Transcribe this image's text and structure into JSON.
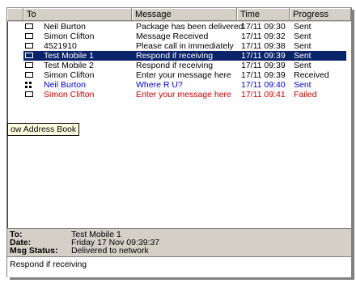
{
  "columns": [
    {
      "key": "icon",
      "label": ""
    },
    {
      "key": "to",
      "label": "To"
    },
    {
      "key": "message",
      "label": "Message"
    },
    {
      "key": "time",
      "label": "Time"
    },
    {
      "key": "progress",
      "label": "Progress"
    }
  ],
  "rows": [
    {
      "icon": "message-icon",
      "to": "Neil Burton",
      "message": "Package has been delivered",
      "time": "17/11 09:30",
      "progress": "Sent",
      "color": "#000000",
      "selected": false
    },
    {
      "icon": "message-icon",
      "to": "Simon Clifton",
      "message": "Message Received",
      "time": "17/11 09:32",
      "progress": "Sent",
      "color": "#000000",
      "selected": false
    },
    {
      "icon": "message-icon",
      "to": "4521910",
      "message": "Please call in immediately",
      "time": "17/11 09:38",
      "progress": "Sent",
      "color": "#000000",
      "selected": false
    },
    {
      "icon": "message-icon",
      "to": "Test Mobile 1",
      "message": "Respond if receiving",
      "time": "17/11 09:39",
      "progress": "Sent",
      "color": "#ffffff",
      "selected": true
    },
    {
      "icon": "message-icon",
      "to": "Test Mobile 2",
      "message": "Respond if receiving",
      "time": "17/11 09:39",
      "progress": "Sent",
      "color": "#000000",
      "selected": false
    },
    {
      "icon": "message-icon",
      "to": "Simon Clifton",
      "message": "Enter your message here",
      "time": "17/11 09:39",
      "progress": "Received",
      "color": "#000000",
      "selected": false
    },
    {
      "icon": "group-icon",
      "to": "Neil Burton",
      "message": "Where R U?",
      "time": "17/11 09:40",
      "progress": "Sent",
      "color": "#0000cc",
      "selected": false
    },
    {
      "icon": "message-icon",
      "to": "Simon Clifton",
      "message": "Enter your message here",
      "time": "17/11 09:41",
      "progress": "Failed",
      "color": "#cc0000",
      "selected": false
    }
  ],
  "tooltip": "ow Address Book",
  "details": {
    "to_label": "To:",
    "to_value": "Test Mobile 1",
    "date_label": "Date:",
    "date_value": "Friday 17 Nov 09:39:37",
    "status_label": "Msg Status:",
    "status_value": "Delivered to network"
  },
  "message_body": "Respond if receiving",
  "colors": {
    "header_bg": "#d4d0c8",
    "selection": "#0a246a",
    "failed": "#cc0000",
    "blue": "#0000cc"
  }
}
